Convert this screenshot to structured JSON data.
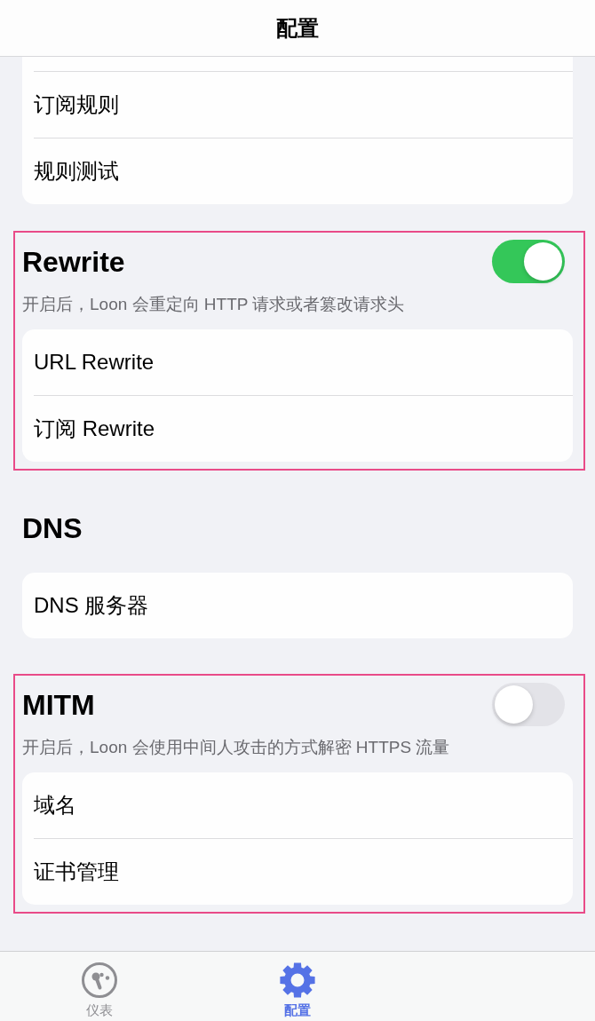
{
  "nav_bar": {
    "title": "配置"
  },
  "sections": [
    {
      "highlighted": false,
      "rows": [
        {
          "label": "订阅规则"
        },
        {
          "label": "规则测试"
        }
      ]
    },
    {
      "title": "Rewrite",
      "highlighted": true,
      "toggle": {
        "on": true
      },
      "description": "开启后，Loon 会重定向 HTTP 请求或者篡改请求头",
      "rows": [
        {
          "label": "URL Rewrite"
        },
        {
          "label": "订阅 Rewrite"
        }
      ]
    },
    {
      "title": "DNS",
      "highlighted": false,
      "rows": [
        {
          "label": "DNS 服务器"
        }
      ]
    },
    {
      "title": "MITM",
      "highlighted": true,
      "toggle": {
        "on": false
      },
      "description": "开启后，Loon 会使用中间人攻击的方式解密 HTTPS 流量",
      "rows": [
        {
          "label": "域名"
        },
        {
          "label": "证书管理"
        }
      ]
    }
  ],
  "tab_bar": {
    "tabs": [
      {
        "label": "仪表",
        "kind": "gauge",
        "selected": false
      },
      {
        "label": "配置",
        "kind": "gear",
        "selected": true
      }
    ]
  }
}
